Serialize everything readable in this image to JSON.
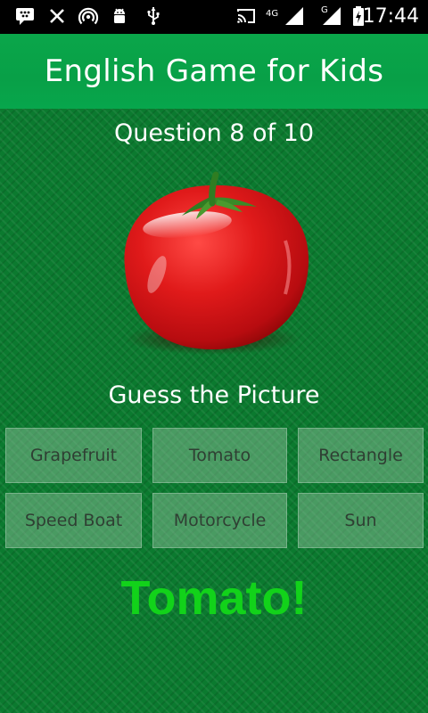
{
  "status_bar": {
    "time": "17:44",
    "network_labels": [
      "4G",
      "G"
    ],
    "icons": [
      "bbm-icon",
      "close-icon",
      "hotspot-icon",
      "android-debug-icon",
      "usb-icon",
      "cast-icon",
      "signal-4g-icon",
      "signal-g-icon",
      "battery-icon"
    ]
  },
  "app": {
    "title": "English Game for Kids"
  },
  "game": {
    "question_counter": "Question 8 of 10",
    "picture": {
      "subject_icon": "tomato-icon"
    },
    "prompt": "Guess the Picture",
    "options": [
      "Grapefruit",
      "Tomato",
      "Rectangle",
      "Speed Boat",
      "Motorcycle",
      "Sun"
    ],
    "result": "Tomato!"
  },
  "colors": {
    "status_bar": "#000000",
    "app_bar": "#08a047",
    "background": "#0b7a2f",
    "result_text": "#12d21a",
    "option_text": "#2f3f33",
    "tomato": "#d81416"
  }
}
